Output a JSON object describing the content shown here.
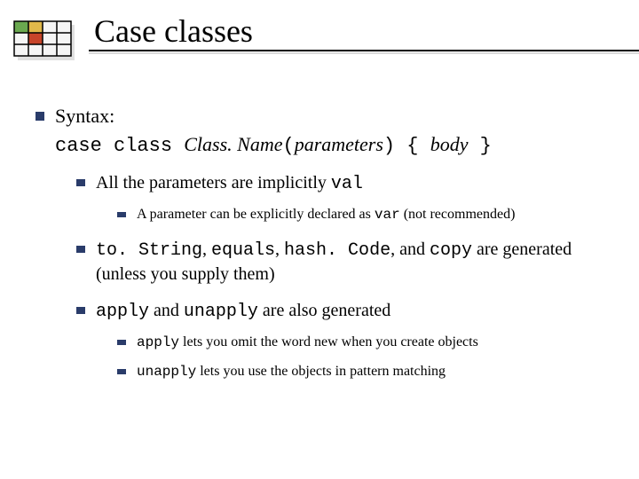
{
  "title": "Case classes",
  "b1_label": "Syntax:",
  "syntax": {
    "s1": "case class ",
    "s2": "Class. Name",
    "s3": "(",
    "s4": "parameters",
    "s5": ")",
    "s6": " { ",
    "s7": "body",
    "s8": " }"
  },
  "b2": {
    "t1": "All the parameters are implicitly ",
    "t2": "val"
  },
  "b3": {
    "t1": " A parameter can be explicitly declared as ",
    "t2": "var",
    "t3": " (not recommended)"
  },
  "b4": {
    "t1": "to. String",
    "t2": ", ",
    "t3": "equals",
    "t4": ", ",
    "t5": "hash. Code",
    "t6": ", and ",
    "t7": "copy",
    "t8": " are generated (unless you supply them)"
  },
  "b5": {
    "t1": "apply",
    "t2": " and ",
    "t3": "unapply",
    "t4": " are also generated"
  },
  "b6": {
    "t1": "apply",
    "t2": " lets you omit the word new when you create objects"
  },
  "b7": {
    "t1": "unapply",
    "t2": " lets you use the objects in pattern matching"
  }
}
